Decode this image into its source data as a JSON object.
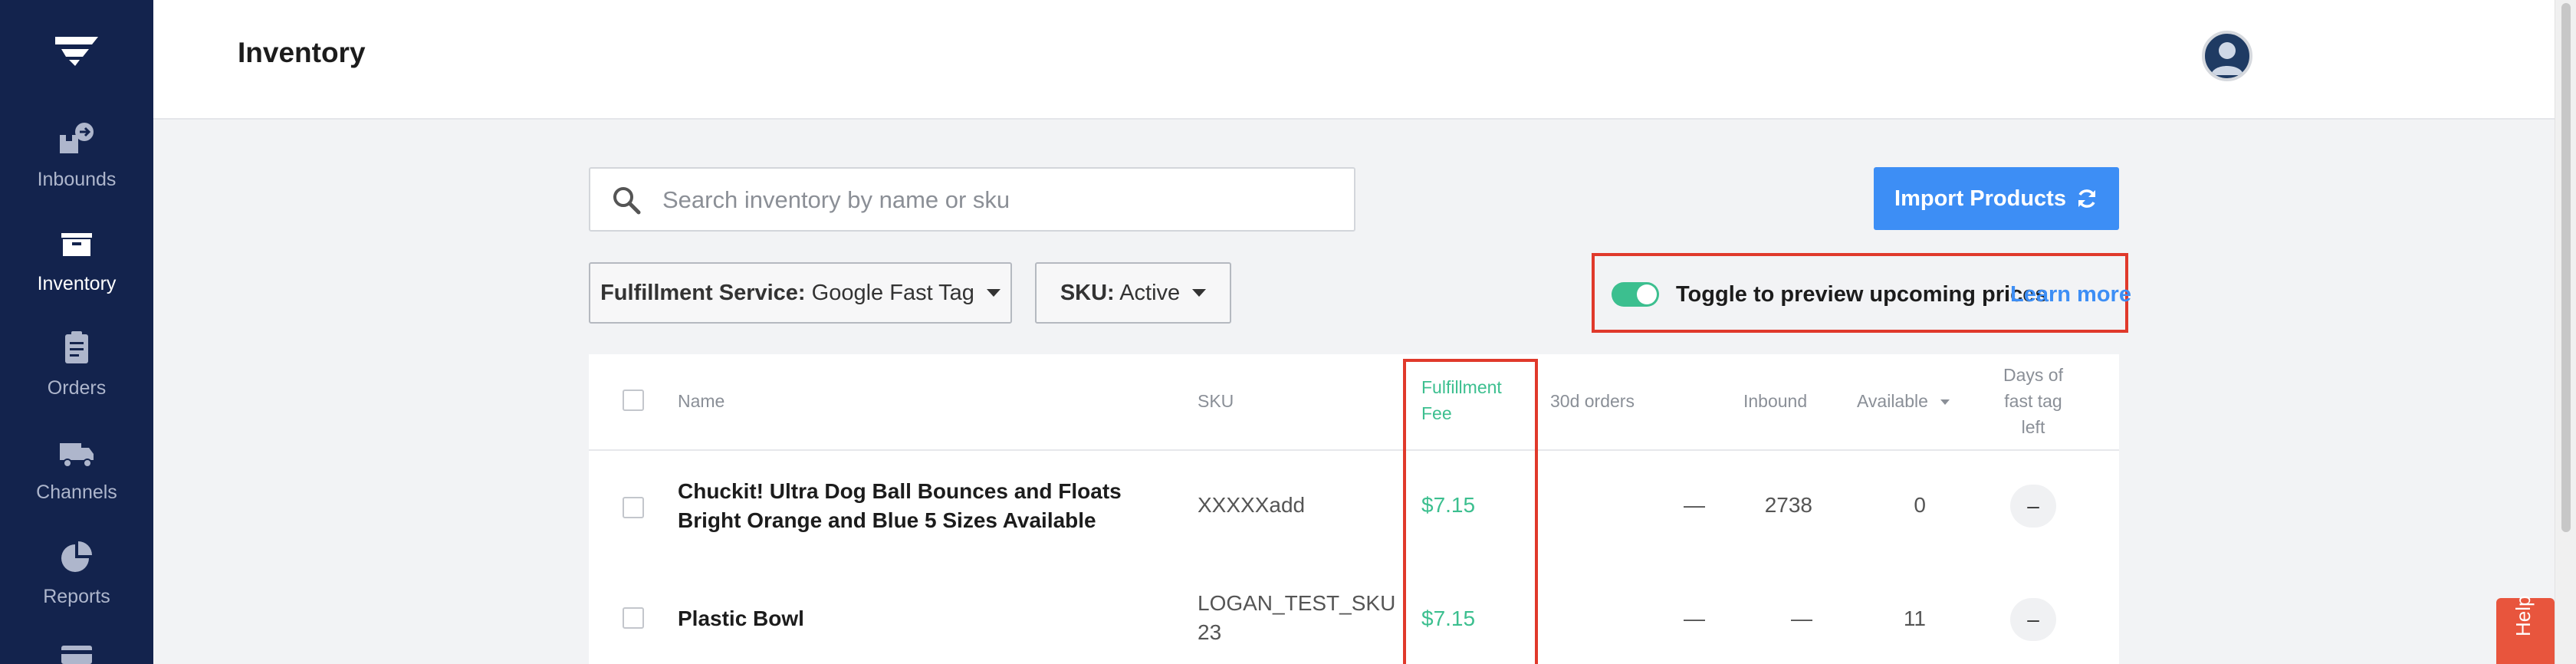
{
  "app": {
    "page_title": "Inventory"
  },
  "sidebar": {
    "items": [
      {
        "label": "Inbounds",
        "icon": "inbound-icon",
        "active": false
      },
      {
        "label": "Inventory",
        "icon": "inventory-box-icon",
        "active": true
      },
      {
        "label": "Orders",
        "icon": "clipboard-icon",
        "active": false
      },
      {
        "label": "Channels",
        "icon": "truck-icon",
        "active": false
      },
      {
        "label": "Reports",
        "icon": "pie-chart-icon",
        "active": false
      }
    ]
  },
  "search": {
    "placeholder": "Search inventory by name or sku",
    "value": ""
  },
  "import_button": {
    "label": "Import Products"
  },
  "filters": {
    "fulfillment": {
      "key": "Fulfillment Service:",
      "value": "Google Fast Tag"
    },
    "sku": {
      "key": "SKU:",
      "value": "Active"
    }
  },
  "preview": {
    "text": "Toggle to preview upcoming prices",
    "link": "Learn more",
    "enabled": true
  },
  "table": {
    "headers": {
      "name": "Name",
      "sku": "SKU",
      "fee": "Fulfillment Fee",
      "orders": "30d orders",
      "inbound": "Inbound",
      "available": "Available",
      "days": "Days of fast tag left"
    },
    "rows": [
      {
        "name": "Chuckit! Ultra Dog Ball Bounces and Floats Bright Orange and Blue 5 Sizes Available",
        "sku": "XXXXXadd",
        "fee": "$7.15",
        "orders": "—",
        "inbound": "2738",
        "available": "0",
        "days": "–"
      },
      {
        "name": "Plastic Bowl",
        "sku": "LOGAN_TEST_SKU23",
        "fee": "$7.15",
        "orders": "—",
        "inbound": "—",
        "available": "11",
        "days": "–"
      }
    ]
  },
  "help": {
    "label": "Help"
  },
  "colors": {
    "sidebar": "#13234d",
    "accent": "#3d8ef5",
    "fee_green": "#3cbf8f",
    "highlight_red": "#e0392b"
  }
}
